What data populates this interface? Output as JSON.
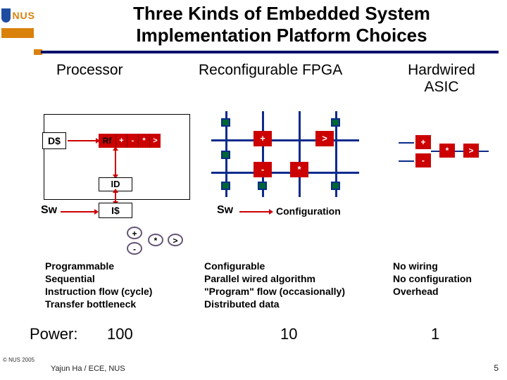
{
  "slide": {
    "title": "Three Kinds of Embedded System Implementation Platform Choices",
    "page_number": "5",
    "footer": "Yajun Ha / ECE, NUS",
    "copyright": "© NUS 2005",
    "logo_text": "NUS"
  },
  "columns": {
    "processor": {
      "header": "Processor",
      "dcache": "D$",
      "rf": "Rf",
      "alu_ops": [
        "+",
        "-",
        "*",
        ">"
      ],
      "id": "ID",
      "icache": "I$",
      "sw": "Sw",
      "bubble_ops": [
        "+",
        "-",
        "*",
        ">"
      ],
      "desc": [
        "Programmable",
        "Sequential",
        "Instruction flow (cycle)",
        "Transfer bottleneck"
      ],
      "power": "100"
    },
    "fpga": {
      "header": "Reconfigurable FPGA",
      "ops": {
        "plus": "+",
        "gt": ">",
        "minus": "-",
        "star": "*"
      },
      "sw": "Sw",
      "config_label": "Configuration",
      "desc": [
        "Configurable",
        "Parallel wired algorithm",
        "\"Program\" flow (occasionally)",
        "Distributed data"
      ],
      "power": "10"
    },
    "asic": {
      "header": "Hardwired ASIC",
      "ops": {
        "plus": "+",
        "minus": "-",
        "star": "*",
        "gt": ">"
      },
      "desc": [
        "No wiring",
        "No configuration",
        "Overhead"
      ],
      "power": "1"
    }
  },
  "power_label": "Power:"
}
